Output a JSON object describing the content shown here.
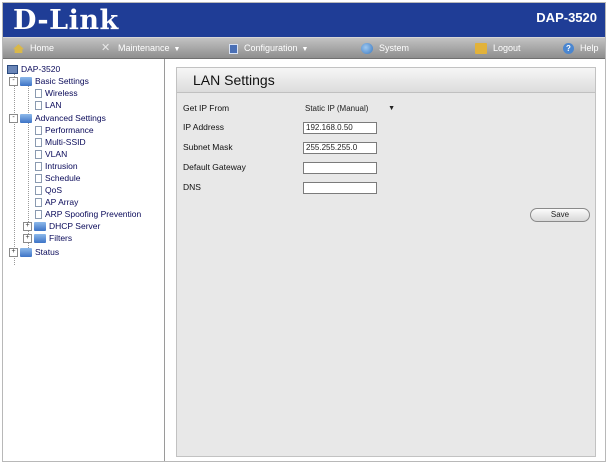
{
  "brand": {
    "logo": "D-Link",
    "model": "DAP-3520"
  },
  "nav": {
    "items": [
      {
        "label": "Home",
        "icon": "home-icon",
        "has_caret": false
      },
      {
        "label": "Maintenance",
        "icon": "tools-icon",
        "has_caret": true
      },
      {
        "label": "Configuration",
        "icon": "config-icon",
        "has_caret": true
      },
      {
        "label": "System",
        "icon": "system-icon",
        "has_caret": false
      },
      {
        "label": "Logout",
        "icon": "logout-icon",
        "has_caret": false
      },
      {
        "label": "Help",
        "icon": "help-icon",
        "has_caret": false
      }
    ]
  },
  "sidebar": {
    "root": "DAP-3520",
    "basic": "Basic Settings",
    "wireless": "Wireless",
    "lan": "LAN",
    "advanced": "Advanced Settings",
    "performance": "Performance",
    "multi_ssid": "Multi-SSID",
    "vlan": "VLAN",
    "intrusion": "Intrusion",
    "schedule": "Schedule",
    "qos": "QoS",
    "ap_array": "AP Array",
    "arp": "ARP Spoofing Prevention",
    "dhcp": "DHCP Server",
    "filters": "Filters",
    "status": "Status",
    "toggle_minus": "-",
    "toggle_plus": "+"
  },
  "panel": {
    "title": "LAN Settings",
    "get_ip_label": "Get IP From",
    "get_ip_value": "Static IP (Manual)",
    "ip_label": "IP Address",
    "ip_value": "192.168.0.50",
    "mask_label": "Subnet Mask",
    "mask_value": "255.255.255.0",
    "gateway_label": "Default Gateway",
    "gateway_value": "",
    "dns_label": "DNS",
    "dns_value": "",
    "save_label": "Save"
  },
  "colors": {
    "header_bg": "#1f3d96",
    "panel_bg": "#e8e8e8"
  }
}
